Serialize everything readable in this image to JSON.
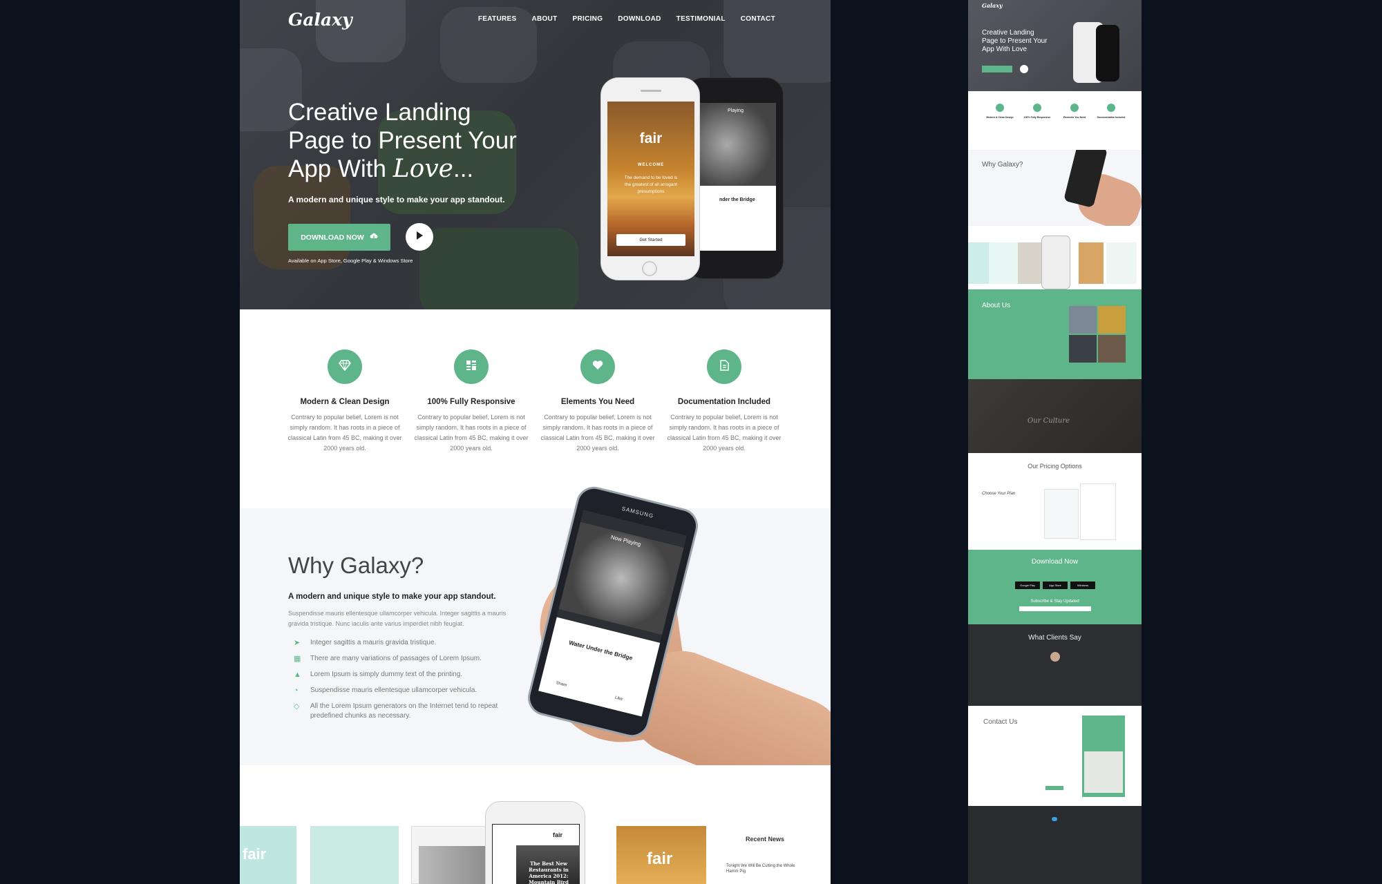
{
  "brand": {
    "logo": "Galaxy",
    "accent": "#5fb58a"
  },
  "nav": {
    "items": [
      "FEATURES",
      "ABOUT",
      "PRICING",
      "DOWNLOAD",
      "TESTIMONIAL",
      "CONTACT"
    ]
  },
  "hero": {
    "title_line1": "Creative Landing",
    "title_line2": "Page to Present Your",
    "title_line3": "App With ",
    "title_love": "Love",
    "title_dots": "...",
    "subtitle": "A modern and unique style to make your app standout.",
    "download_button": "DOWNLOAD NOW",
    "availability": "Available on App Store, Google Play & Windows Store",
    "phone": {
      "app": "fair",
      "welcome": "WELCOME",
      "quote": "The demand to be loved is the greatest of all arrogant presumptions",
      "cta": "Get Started",
      "playing": "Playing",
      "track": "nder the Bridge"
    }
  },
  "features": [
    {
      "icon": "diamond-icon",
      "title": "Modern & Clean Design",
      "text": "Contrary to popular belief, Lorem is not simply random. It has roots in a piece of classical Latin from 45 BC, making it over 2000 years old."
    },
    {
      "icon": "grid-icon",
      "title": "100% Fully Responsive",
      "text": "Contrary to popular belief, Lorem is not simply random. It has roots in a piece of classical Latin from 45 BC, making it over 2000 years old."
    },
    {
      "icon": "heart-icon",
      "title": "Elements You Need",
      "text": "Contrary to popular belief, Lorem is not simply random. It has roots in a piece of classical Latin from 45 BC, making it over 2000 years old."
    },
    {
      "icon": "document-icon",
      "title": "Documentation Included",
      "text": "Contrary to popular belief, Lorem is not simply random. It has roots in a piece of classical Latin from 45 BC, making it over 2000 years old."
    }
  ],
  "why": {
    "title": "Why Galaxy?",
    "subtitle": "A modern and unique style to make your app standout.",
    "desc": "Suspendisse mauris ellentesque ullamcorper vehicula. Integer sagittis a mauris gravida tristique. Nunc iaculis ante varius imperdiet nibh feugiat.",
    "list": [
      {
        "icon": "paper-plane-icon",
        "text": "Integer sagittis a mauris gravida tristique."
      },
      {
        "icon": "cubes-icon",
        "text": "There are many variations of passages of Lorem Ipsum."
      },
      {
        "icon": "tree-icon",
        "text": "Lorem Ipsum is simply dummy text of the printing."
      },
      {
        "icon": "rss-icon",
        "text": "Suspendisse mauris ellentesque ullamcorper vehicula."
      },
      {
        "icon": "diamond-icon",
        "text": "All the Lorem Ipsum generators on the Internet tend to repeat predefined chunks as necessary."
      }
    ],
    "phone": {
      "brand": "SAMSUNG",
      "now_playing": "Now Playing",
      "track": "Water Under the Bridge",
      "share": "Share",
      "like": "Like"
    }
  },
  "showcase": {
    "app": "fair",
    "recent": "Recent News",
    "headline": "The Best New Restaurants in America 2012: Mountain Bird",
    "news_item": "Tonight We Will Be Cutting the Whole Hamm Pig"
  },
  "thumb": {
    "hero_title1": "Creative Landing",
    "hero_title2": "Page to Present Your",
    "hero_title3": "App With Love",
    "why": "Why Galaxy?",
    "about": "About Us",
    "culture": "Our Culture",
    "pricing": "Our Pricing Options",
    "pricing_plan": "Choose Your Plan",
    "download": "Download Now",
    "subscribe": "Subscribe & Stay Updated",
    "clients": "What Clients Say",
    "contact": "Contact Us",
    "stores": [
      "Google Play",
      "App Store",
      "Windows"
    ],
    "features": [
      "Modern & Clean Design",
      "100% Fully Responsive",
      "Elements You Need",
      "Documentation Included"
    ]
  }
}
